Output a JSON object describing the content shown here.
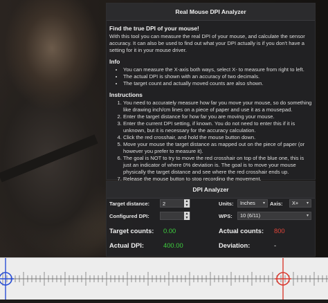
{
  "info_panel": {
    "title": "Real Mouse DPI Analyzer",
    "intro_heading": "Find the true DPI of your mouse!",
    "intro_text": "With this tool you can measure the real DPI of your mouse, and calculate the sensor accuracy. It can also be used to find out what your DPI actually is if you don't have a setting for it in your mouse driver.",
    "info_heading": "Info",
    "info_items": [
      "You can measure the X-axis both ways, select X- to measure from right to left.",
      "The actual DPI is shown with an accuracy of two decimals.",
      "The target count and actually moved counts are also shown."
    ],
    "instructions_heading": "Instructions",
    "instructions": [
      "You need to accurately measure how far you move your mouse, so do something like drawing inch/cm lines on a piece of paper and use it as a mousepad.",
      "Enter the target distance for how far you are moving your mouse.",
      "Enter the current DPI setting, if known. You do not need to enter this if it is unknown, but it is necessary for the accuracy calculation.",
      "Click the red crosshair, and hold the mouse button down.",
      "Move your mouse the target distance as mapped out on the piece of paper (or however you prefer to measure it).",
      "The goal is NOT to try to move the red crosshair on top of the blue one, this is just an indicator of where 0% deviation is. The goal is to move your mouse physically the target distance and see where the red crosshair ends up.",
      "Release the mouse button to stop recording the movement."
    ]
  },
  "analyzer": {
    "title": "DPI Analyzer",
    "target_distance_label": "Target distance:",
    "target_distance_value": "2",
    "configured_dpi_label": "Configured DPI:",
    "configured_dpi_value": "",
    "units_label": "Units:",
    "units_value": "Inches",
    "axis_label": "Axis:",
    "axis_value": "X+",
    "wps_label": "WPS:",
    "wps_value": "10 (6/11)",
    "target_counts_label": "Target counts:",
    "target_counts_value": "0.00",
    "actual_counts_label": "Actual counts:",
    "actual_counts_value": "800",
    "actual_dpi_label": "Actual DPI:",
    "actual_dpi_value": "400.00",
    "deviation_label": "Deviation:",
    "deviation_value": "-"
  },
  "colors": {
    "green_value": "#3ecf3e",
    "red_value": "#e0453a",
    "blue_crosshair": "#2a4fd6",
    "red_crosshair": "#d93a30"
  },
  "icons": {
    "blue_crosshair": "crosshair-blue-icon",
    "red_crosshair": "crosshair-red-icon"
  }
}
